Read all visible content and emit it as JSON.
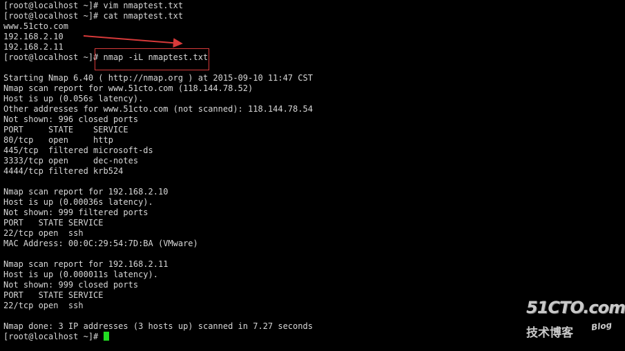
{
  "terminal": {
    "lines": [
      "[root@localhost ~]# vim nmaptest.txt",
      "[root@localhost ~]# cat nmaptest.txt",
      "www.51cto.com",
      "192.168.2.10",
      "192.168.2.11",
      "[root@localhost ~]# nmap -iL nmaptest.txt",
      "",
      "Starting Nmap 6.40 ( http://nmap.org ) at 2015-09-10 11:47 CST",
      "Nmap scan report for www.51cto.com (118.144.78.52)",
      "Host is up (0.056s latency).",
      "Other addresses for www.51cto.com (not scanned): 118.144.78.54",
      "Not shown: 996 closed ports",
      "PORT     STATE    SERVICE",
      "80/tcp   open     http",
      "445/tcp  filtered microsoft-ds",
      "3333/tcp open     dec-notes",
      "4444/tcp filtered krb524",
      "",
      "Nmap scan report for 192.168.2.10",
      "Host is up (0.00036s latency).",
      "Not shown: 999 filtered ports",
      "PORT   STATE SERVICE",
      "22/tcp open  ssh",
      "MAC Address: 00:0C:29:54:7D:BA (VMware)",
      "",
      "Nmap scan report for 192.168.2.11",
      "Host is up (0.000011s latency).",
      "Not shown: 999 closed ports",
      "PORT   STATE SERVICE",
      "22/tcp open  ssh",
      "",
      "Nmap done: 3 IP addresses (3 hosts up) scanned in 7.27 seconds"
    ],
    "prompt": "[root@localhost ~]# "
  },
  "watermark": {
    "main": "51CTO.com",
    "sub": "技术博客",
    "blog": "Blog"
  },
  "colors": {
    "background": "#000000",
    "text": "#d8d8d8",
    "cursor": "#22dd22",
    "annotation": "#d83a3a"
  }
}
